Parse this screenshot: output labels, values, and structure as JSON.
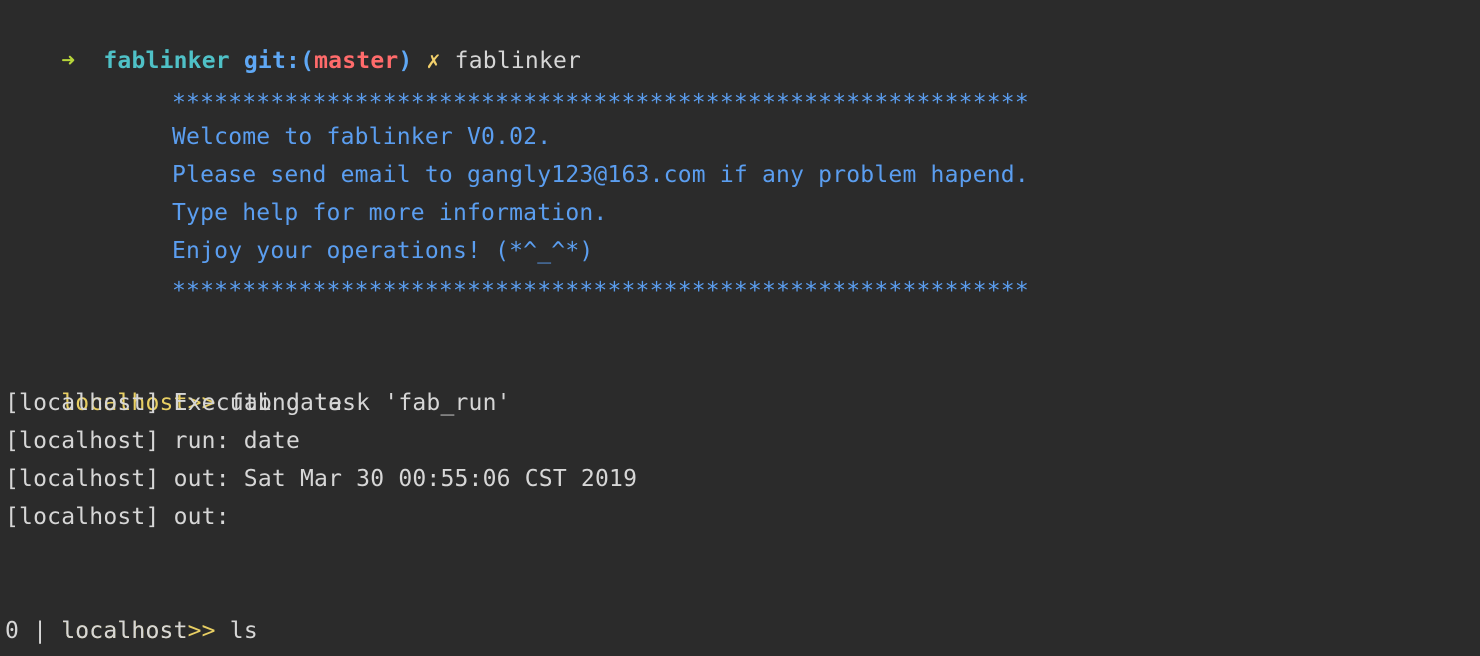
{
  "shell_prompt": {
    "arrow": "➜",
    "directory": "fablinker",
    "git_prefix": "git:(",
    "branch": "master",
    "git_suffix": ")",
    "dirty_mark": "✗",
    "command": "fablinker"
  },
  "banner": {
    "border_top": "*************************************************************",
    "lines": [
      "Welcome to fablinker V0.02.",
      "Please send email to gangly123@163.com if any problem hapend.",
      "Type help for more information.",
      "Enjoy your operations! (*^_^*)"
    ],
    "border_bottom": "*************************************************************"
  },
  "session_1": {
    "prompt": "localhost>>",
    "command": " fab date",
    "output": [
      "[localhost] Executing task 'fab_run'",
      "[localhost] run: date",
      "[localhost] out: Sat Mar 30 00:55:06 CST 2019",
      "[localhost] out:"
    ]
  },
  "session_2": {
    "prompt": "localhost>>",
    "command": " ls",
    "output": [
      "0 | localhost"
    ]
  },
  "colors": {
    "background": "#2b2b2b",
    "foreground": "#d6d6d6",
    "banner": "#5b9ef0",
    "prompt": "#e8cf63",
    "branch": "#ff6b6b",
    "directory": "#4fc1c7"
  }
}
